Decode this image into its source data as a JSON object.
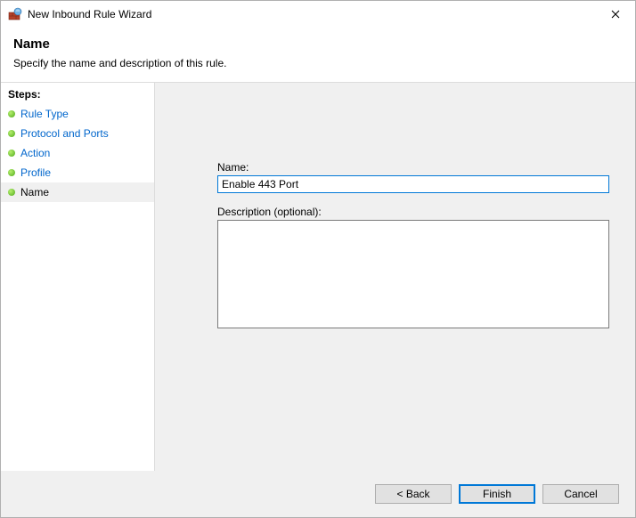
{
  "window": {
    "title": "New Inbound Rule Wizard"
  },
  "header": {
    "heading": "Name",
    "subtitle": "Specify the name and description of this rule."
  },
  "sidebar": {
    "steps_label": "Steps:",
    "steps": [
      {
        "label": "Rule Type",
        "current": false
      },
      {
        "label": "Protocol and Ports",
        "current": false
      },
      {
        "label": "Action",
        "current": false
      },
      {
        "label": "Profile",
        "current": false
      },
      {
        "label": "Name",
        "current": true
      }
    ]
  },
  "form": {
    "name_label": "Name:",
    "name_value": "Enable 443 Port",
    "desc_label": "Description (optional):",
    "desc_value": ""
  },
  "buttons": {
    "back": "< Back",
    "finish": "Finish",
    "cancel": "Cancel"
  }
}
